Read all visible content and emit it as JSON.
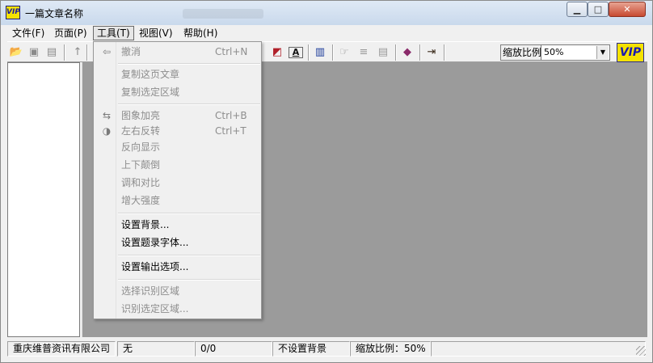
{
  "window": {
    "title": "一篇文章名称",
    "app_icon_text": "VIP",
    "minimize_glyph": "▁",
    "maximize_glyph": "□",
    "close_glyph": "✕"
  },
  "menubar": {
    "items": [
      {
        "label": "文件(F)"
      },
      {
        "label": "页面(P)"
      },
      {
        "label": "工具(T)"
      },
      {
        "label": "视图(V)"
      },
      {
        "label": "帮助(H)"
      }
    ]
  },
  "toolbar": {
    "zoom_label": "缩放比例",
    "zoom_value": "50%",
    "zoom_arrow": "▼",
    "logo_text": "VIP",
    "icons": {
      "open": "📂",
      "save": "▣",
      "print": "▤",
      "up": "↑",
      "page": "▯",
      "color": "◩",
      "font": "A",
      "books": "▥",
      "recog": "☞",
      "text": "≡",
      "doc": "▤",
      "book": "◆",
      "exit": "⇥"
    }
  },
  "dropdown": {
    "items": [
      {
        "label": "撤消",
        "shortcut": "Ctrl+N",
        "icon": "⇦"
      },
      {
        "label": "复制这页文章"
      },
      {
        "label": "复制选定区域"
      },
      {
        "label": "图象加亮",
        "shortcut": "Ctrl+B",
        "icon": "⇆"
      },
      {
        "label": "左右反转",
        "shortcut": "Ctrl+T",
        "icon": "◑"
      },
      {
        "label": "反向显示"
      },
      {
        "label": "上下颠倒"
      },
      {
        "label": "调和对比"
      },
      {
        "label": "增大强度"
      },
      {
        "label": "设置背景..."
      },
      {
        "label": "设置题录字体..."
      },
      {
        "label": "设置输出选项..."
      },
      {
        "label": "选择识别区域"
      },
      {
        "label": "识别选定区域..."
      }
    ]
  },
  "statusbar": {
    "company": "重庆维普资讯有限公司",
    "field2": "无",
    "page": "0/0",
    "background": "不设置背景",
    "zoom": "缩放比例：50%"
  }
}
